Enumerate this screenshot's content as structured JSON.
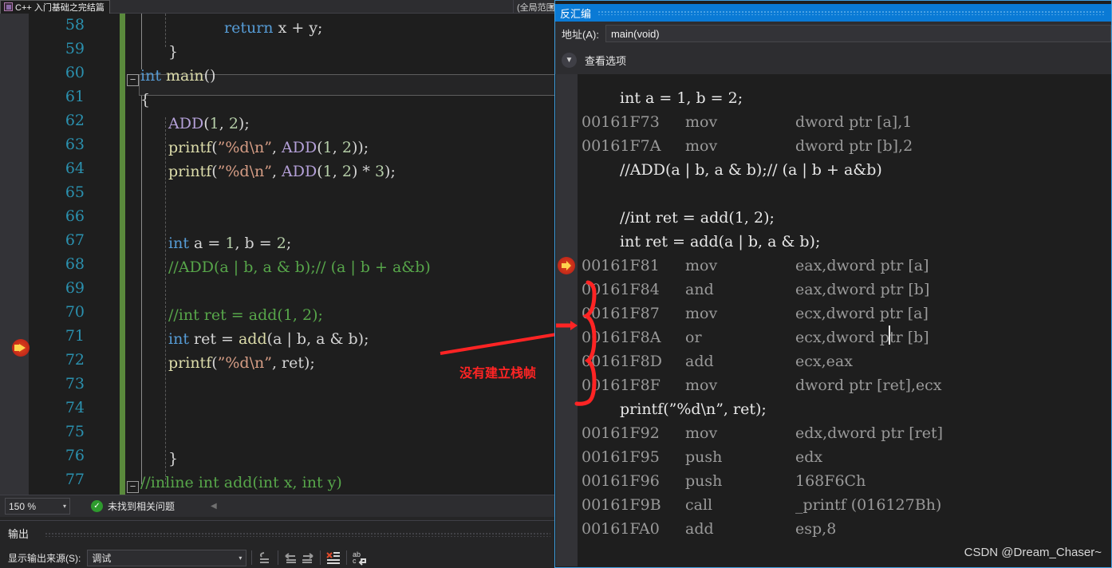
{
  "editor": {
    "tab_label": "C++ 入门基础之完结篇",
    "tab_icon": "cpp-file-icon",
    "scope_text": "(全局范围)",
    "zoom_level": "150 %",
    "issue_status": "未找到相关问题",
    "lines": [
      {
        "no": "58",
        "indent": 3,
        "text": "return x + y;"
      },
      {
        "no": "59",
        "indent": 1,
        "text": "}"
      },
      {
        "no": "60",
        "indent": 0,
        "text": "int main()"
      },
      {
        "no": "61",
        "indent": 0,
        "text": "{"
      },
      {
        "no": "62",
        "indent": 1,
        "text": "ADD(1, 2);"
      },
      {
        "no": "63",
        "indent": 1,
        "text": "printf(\"%d\\n\", ADD(1, 2));"
      },
      {
        "no": "64",
        "indent": 1,
        "text": "printf(\"%d\\n\", ADD(1, 2) * 3);"
      },
      {
        "no": "65",
        "indent": 0,
        "text": ""
      },
      {
        "no": "66",
        "indent": 0,
        "text": ""
      },
      {
        "no": "67",
        "indent": 1,
        "text": "int a = 1, b = 2;"
      },
      {
        "no": "68",
        "indent": 1,
        "text": "//ADD(a | b, a & b);// (a | b + a&b)"
      },
      {
        "no": "69",
        "indent": 0,
        "text": ""
      },
      {
        "no": "70",
        "indent": 1,
        "text": "//int ret = add(1, 2);"
      },
      {
        "no": "71",
        "indent": 1,
        "text": "int ret = add(a | b, a & b);"
      },
      {
        "no": "72",
        "indent": 1,
        "text": "printf(\"%d\\n\", ret);"
      },
      {
        "no": "73",
        "indent": 0,
        "text": ""
      },
      {
        "no": "74",
        "indent": 0,
        "text": ""
      },
      {
        "no": "75",
        "indent": 0,
        "text": ""
      },
      {
        "no": "76",
        "indent": 1,
        "text": "}"
      },
      {
        "no": "77",
        "indent": 0,
        "text": "//inline int add(int x, int y)"
      }
    ],
    "annotation_text": "没有建立栈帧"
  },
  "output": {
    "title": "输出",
    "source_label": "显示输出来源(S):",
    "source_value": "调试",
    "toolbar_icons": [
      "find-message-icon",
      "previous-message-icon",
      "next-message-icon",
      "clear-all-icon",
      "word-wrap-icon"
    ]
  },
  "disassembly": {
    "title": "反汇编",
    "address_label": "地址(A):",
    "address_value": "main(void)",
    "view_options_label": "查看选项",
    "rows": [
      {
        "kind": "src",
        "text": "int a = 1, b = 2;"
      },
      {
        "kind": "asm",
        "addr": "00161F73",
        "op": "mov",
        "arg": "dword ptr [a],1"
      },
      {
        "kind": "asm",
        "addr": "00161F7A",
        "op": "mov",
        "arg": "dword ptr [b],2"
      },
      {
        "kind": "src",
        "text": "//ADD(a | b, a & b);// (a | b + a&b)"
      },
      {
        "kind": "blank",
        "text": ""
      },
      {
        "kind": "src",
        "text": "//int ret = add(1, 2);"
      },
      {
        "kind": "src",
        "text": "int ret = add(a | b, a & b);"
      },
      {
        "kind": "asm",
        "addr": "00161F81",
        "op": "mov",
        "arg": "eax,dword ptr [a]",
        "current": true
      },
      {
        "kind": "asm",
        "addr": "00161F84",
        "op": "and",
        "arg": "eax,dword ptr [b]"
      },
      {
        "kind": "asm",
        "addr": "00161F87",
        "op": "mov",
        "arg": "ecx,dword ptr [a]",
        "caret": true
      },
      {
        "kind": "asm",
        "addr": "00161F8A",
        "op": "or",
        "arg": "ecx,dword ptr [b]"
      },
      {
        "kind": "asm",
        "addr": "00161F8D",
        "op": "add",
        "arg": "ecx,eax"
      },
      {
        "kind": "asm",
        "addr": "00161F8F",
        "op": "mov",
        "arg": "dword ptr [ret],ecx"
      },
      {
        "kind": "src",
        "text": "printf(\"%d\\n\", ret);"
      },
      {
        "kind": "asm",
        "addr": "00161F92",
        "op": "mov",
        "arg": "edx,dword ptr [ret]"
      },
      {
        "kind": "asm",
        "addr": "00161F95",
        "op": "push",
        "arg": "edx"
      },
      {
        "kind": "asm",
        "addr": "00161F96",
        "op": "push",
        "arg": "168F6Ch"
      },
      {
        "kind": "asm",
        "addr": "00161F9B",
        "op": "call",
        "arg": "_printf (016127Bh)"
      },
      {
        "kind": "asm",
        "addr": "00161FA0",
        "op": "add",
        "arg": "esp,8"
      }
    ]
  },
  "watermark": "CSDN @Dream_Chaser~",
  "colors": {
    "accent_blue": "#0a7ad5",
    "annotation_red": "#ff2424",
    "breakpoint_red": "#c1271a",
    "current_arrow_yellow": "#ffd34d",
    "editor_bg": "#1e1e1e",
    "line_number": "#2b91af"
  }
}
